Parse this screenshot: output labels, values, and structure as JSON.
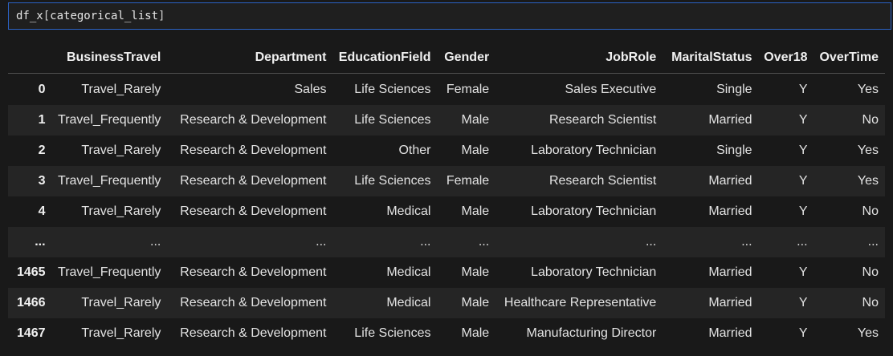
{
  "cell": {
    "code_prefix": "df_x",
    "code_open": "[",
    "code_inner": "categorical_list",
    "code_close": "]"
  },
  "table": {
    "columns": [
      "",
      "BusinessTravel",
      "Department",
      "EducationField",
      "Gender",
      "JobRole",
      "MaritalStatus",
      "Over18",
      "OverTime"
    ],
    "rows": [
      [
        "0",
        "Travel_Rarely",
        "Sales",
        "Life Sciences",
        "Female",
        "Sales Executive",
        "Single",
        "Y",
        "Yes"
      ],
      [
        "1",
        "Travel_Frequently",
        "Research & Development",
        "Life Sciences",
        "Male",
        "Research Scientist",
        "Married",
        "Y",
        "No"
      ],
      [
        "2",
        "Travel_Rarely",
        "Research & Development",
        "Other",
        "Male",
        "Laboratory Technician",
        "Single",
        "Y",
        "Yes"
      ],
      [
        "3",
        "Travel_Frequently",
        "Research & Development",
        "Life Sciences",
        "Female",
        "Research Scientist",
        "Married",
        "Y",
        "Yes"
      ],
      [
        "4",
        "Travel_Rarely",
        "Research & Development",
        "Medical",
        "Male",
        "Laboratory Technician",
        "Married",
        "Y",
        "No"
      ],
      [
        "...",
        "...",
        "...",
        "...",
        "...",
        "...",
        "...",
        "...",
        "..."
      ],
      [
        "1465",
        "Travel_Frequently",
        "Research & Development",
        "Medical",
        "Male",
        "Laboratory Technician",
        "Married",
        "Y",
        "No"
      ],
      [
        "1466",
        "Travel_Rarely",
        "Research & Development",
        "Medical",
        "Male",
        "Healthcare Representative",
        "Married",
        "Y",
        "No"
      ],
      [
        "1467",
        "Travel_Rarely",
        "Research & Development",
        "Life Sciences",
        "Male",
        "Manufacturing Director",
        "Married",
        "Y",
        "Yes"
      ]
    ]
  }
}
